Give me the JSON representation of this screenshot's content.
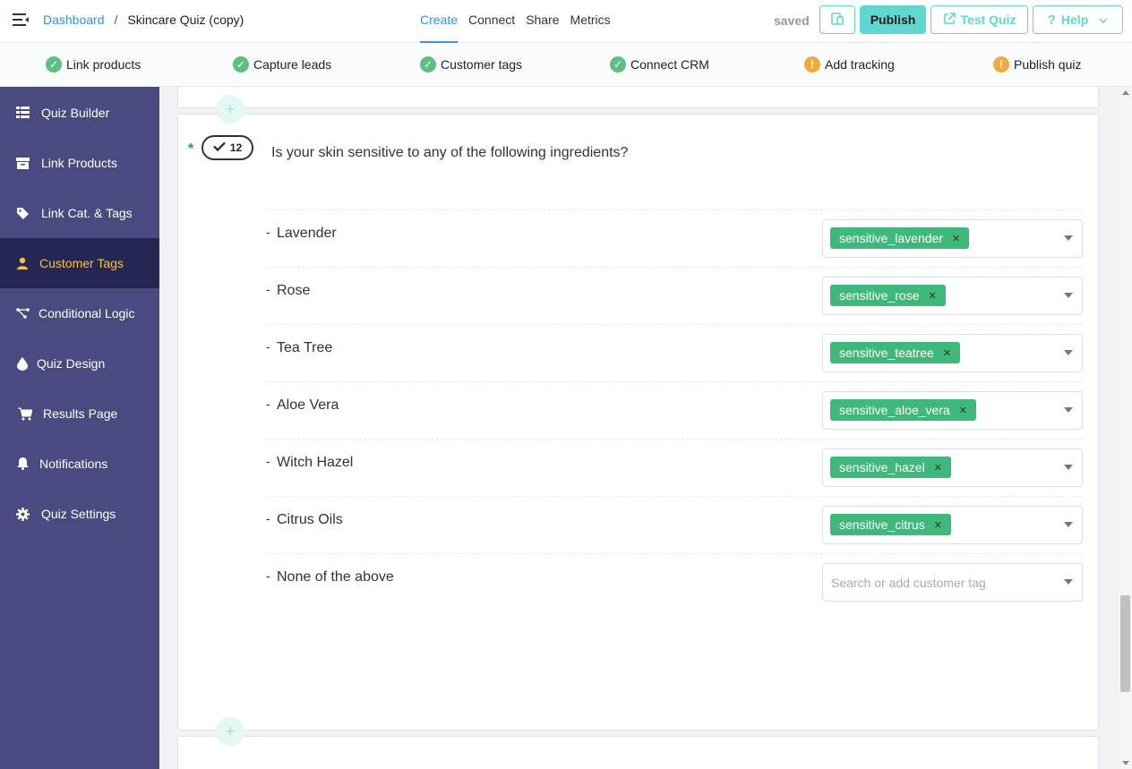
{
  "header": {
    "breadcrumb_root": "Dashboard",
    "breadcrumb_sep": "/",
    "quiz_title": "Skincare Quiz (copy)",
    "tabs": [
      {
        "label": "Create",
        "active": true
      },
      {
        "label": "Connect",
        "active": false
      },
      {
        "label": "Share",
        "active": false
      },
      {
        "label": "Metrics",
        "active": false
      }
    ],
    "status": "saved",
    "publish_label": "Publish",
    "test_label": "Test Quiz",
    "help_label": "Help",
    "accent_color": "#5fd8d0"
  },
  "progress": [
    {
      "label": "Link products",
      "state": "done"
    },
    {
      "label": "Capture leads",
      "state": "done"
    },
    {
      "label": "Customer tags",
      "state": "done"
    },
    {
      "label": "Connect CRM",
      "state": "done"
    },
    {
      "label": "Add tracking",
      "state": "warning"
    },
    {
      "label": "Publish quiz",
      "state": "warning"
    }
  ],
  "sidebar": {
    "items": [
      {
        "label": "Quiz Builder",
        "icon": "grid-list-icon"
      },
      {
        "label": "Link Products",
        "icon": "box-icon"
      },
      {
        "label": "Link Cat. & Tags",
        "icon": "tag-icon"
      },
      {
        "label": "Customer Tags",
        "icon": "user-icon",
        "active": true
      },
      {
        "label": "Conditional Logic",
        "icon": "logic-branch-icon"
      },
      {
        "label": "Quiz Design",
        "icon": "droplet-icon"
      },
      {
        "label": "Results Page",
        "icon": "cart-icon"
      },
      {
        "label": "Notifications",
        "icon": "bell-icon"
      },
      {
        "label": "Quiz Settings",
        "icon": "gear-icon"
      }
    ],
    "bg_color": "#4a4a80",
    "active_bg": "#262654",
    "active_color": "#f5c142"
  },
  "question": {
    "required_mark": "*",
    "number": "12",
    "text": "Is your skin sensitive to any of the following ingredients?",
    "answers": [
      {
        "label": "Lavender",
        "tag": "sensitive_lavender"
      },
      {
        "label": "Rose",
        "tag": "sensitive_rose"
      },
      {
        "label": "Tea Tree",
        "tag": "sensitive_teatree"
      },
      {
        "label": "Aloe Vera",
        "tag": "sensitive_aloe_vera"
      },
      {
        "label": "Witch Hazel",
        "tag": "sensitive_hazel"
      },
      {
        "label": "Citrus Oils",
        "tag": "sensitive_citrus"
      },
      {
        "label": "None of the above",
        "tag": null
      }
    ],
    "tag_placeholder": "Search or add customer tag",
    "tag_color": "#3fb97b"
  }
}
